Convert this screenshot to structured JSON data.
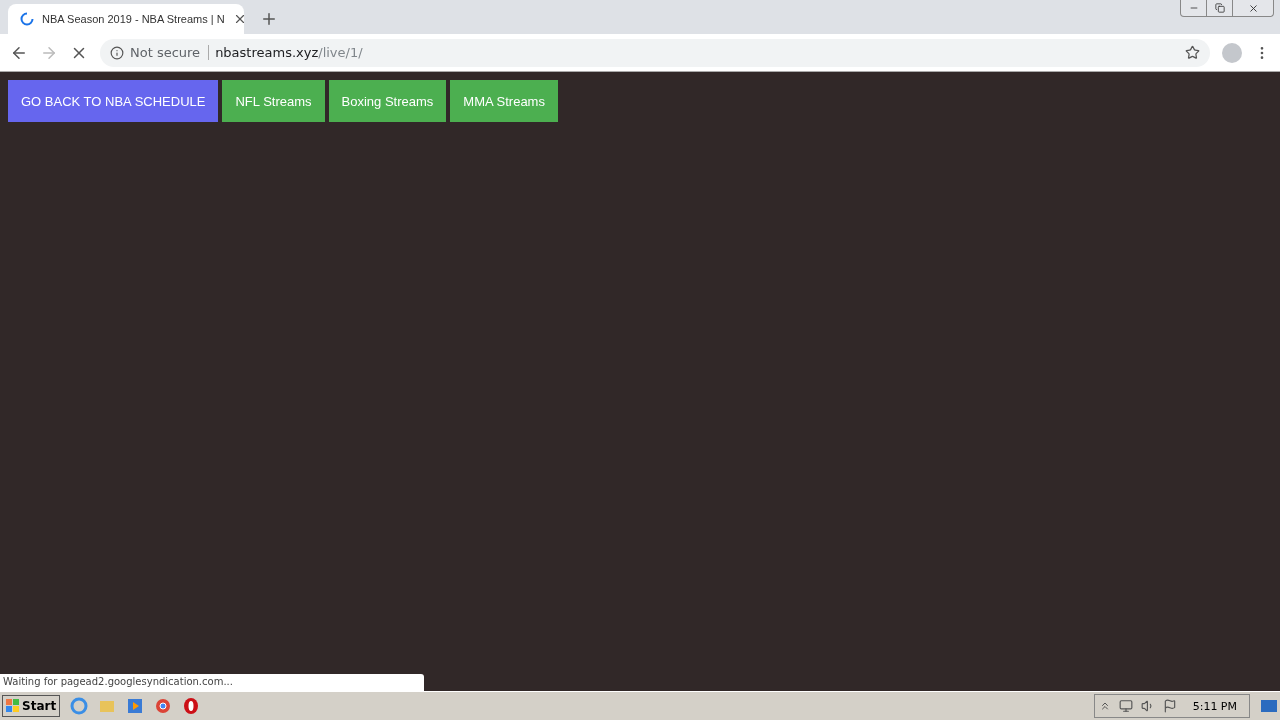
{
  "browser": {
    "tab": {
      "title": "NBA Season 2019 - NBA Streams | N",
      "loading": true
    },
    "address": {
      "security": "Not secure",
      "host": "nbastreams.xyz",
      "path": "/live/1/"
    }
  },
  "nav_buttons": [
    {
      "label": "GO BACK TO NBA SCHEDULE",
      "color": "#6666ee"
    },
    {
      "label": "NFL Streams",
      "color": "#4caf50"
    },
    {
      "label": "Boxing Streams",
      "color": "#4caf50"
    },
    {
      "label": "MMA Streams",
      "color": "#4caf50"
    }
  ],
  "status_bubble": "Waiting for pagead2.googlesyndication.com...",
  "taskbar": {
    "start": "Start",
    "clock": "5:11 PM"
  }
}
